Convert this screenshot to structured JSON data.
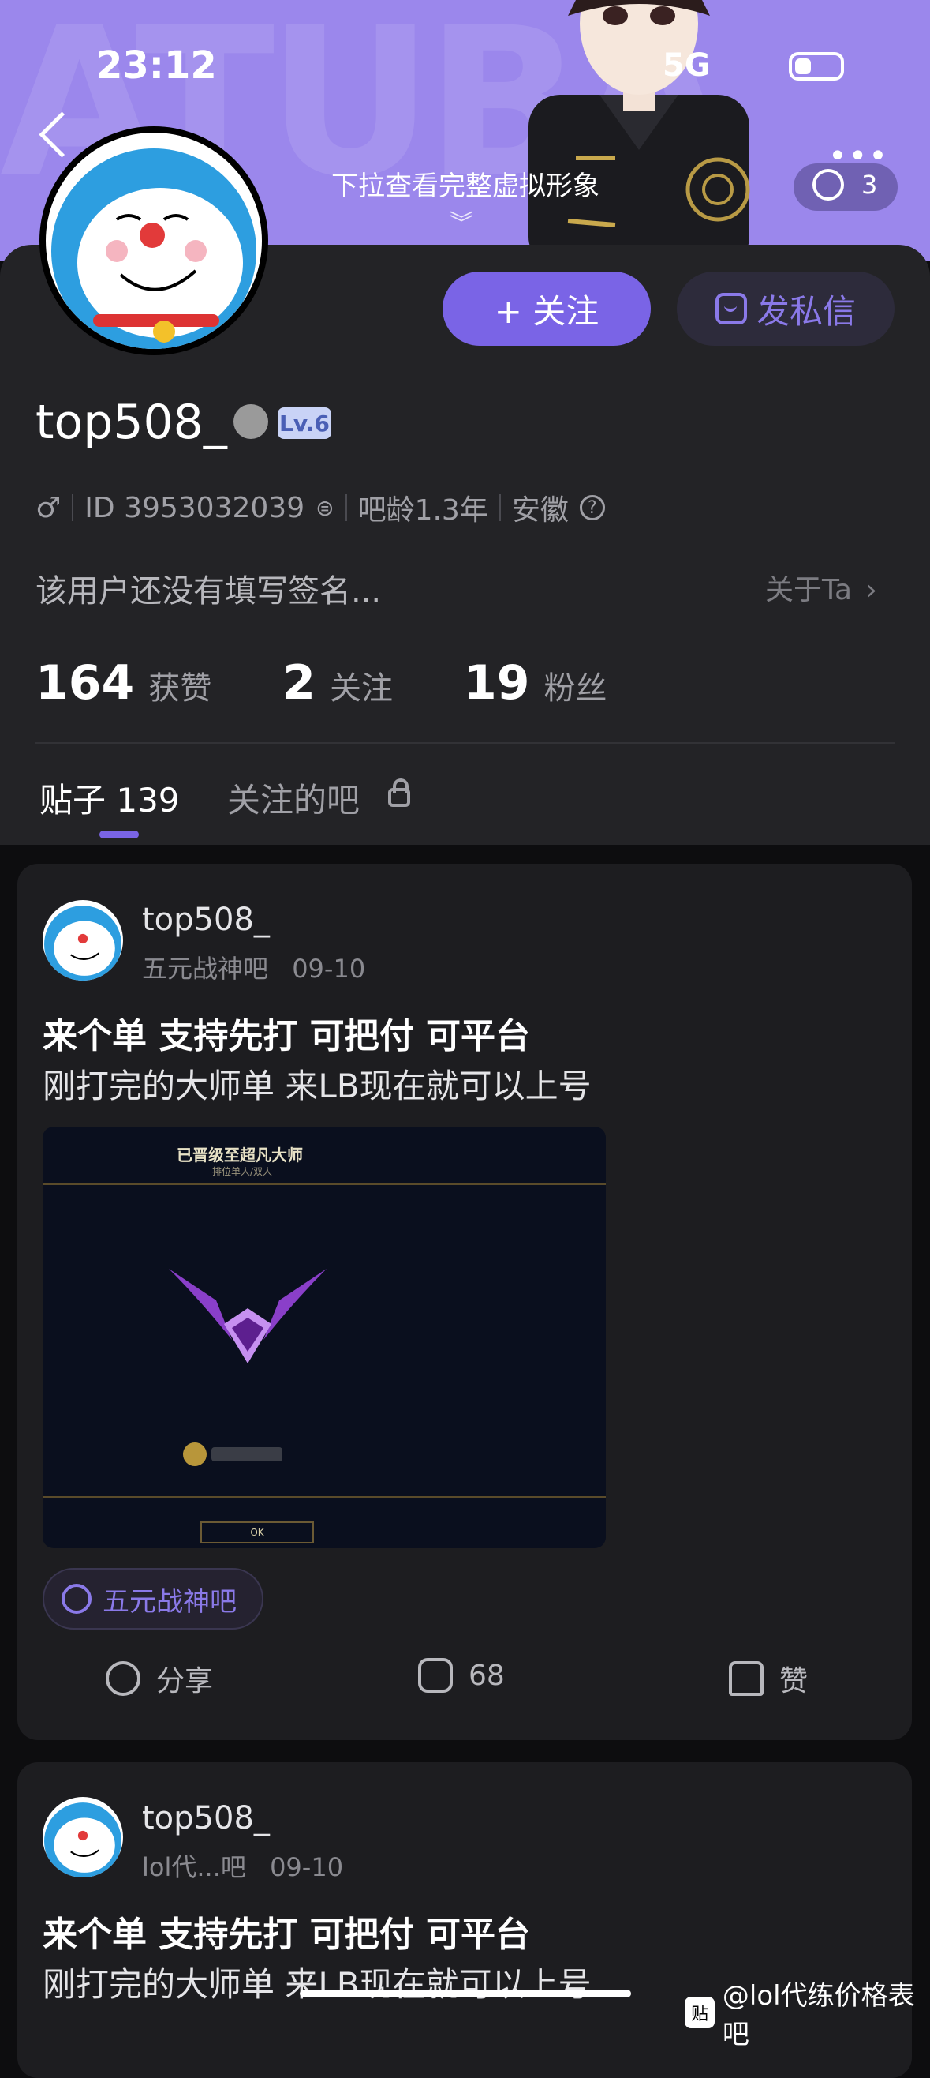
{
  "status_bar": {
    "time": "23:12",
    "network": "5G"
  },
  "header": {
    "pull_hint": "下拉查看完整虚拟形象",
    "visitor_count": "3",
    "bg_color": "#9b87ec"
  },
  "profile": {
    "username": "top508_",
    "level": "Lv.6",
    "gender_symbol": "♂",
    "id_text": "ID 3953032039",
    "bar_age": "吧龄1.3年",
    "location": "安徽",
    "signature": "该用户还没有填写签名...",
    "about_label": "关于Ta",
    "follow_button": "+ 关注",
    "message_button": "发私信",
    "stats": [
      {
        "value": "164",
        "label": "获赞"
      },
      {
        "value": "2",
        "label": "关注"
      },
      {
        "value": "19",
        "label": "粉丝"
      }
    ]
  },
  "tabs": [
    {
      "label": "贴子 139",
      "active": true
    },
    {
      "label": "关注的吧",
      "active": false
    }
  ],
  "posts": [
    {
      "user": "top508_",
      "forum": "五元战神吧",
      "date": "09-10",
      "title": "来个单 支持先打 可把付 可平台",
      "body": "刚打完的大师单 来LB现在就可以上号",
      "image_heading": "已晋级至超凡大师",
      "image_subheading": "排位单人/双人",
      "image_button": "OK",
      "tag": "五元战神吧",
      "actions": {
        "share": "分享",
        "comments": "68",
        "like": "赞"
      }
    },
    {
      "user": "top508_",
      "forum": "lol代...吧",
      "date": "09-10",
      "title": "来个单 支持先打 可把付 可平台",
      "body": "刚打完的大师单 来LB现在就可以上号"
    }
  ],
  "watermark": {
    "badge": "贴",
    "text": "@lol代练价格表吧"
  },
  "colors": {
    "accent": "#7a64e6",
    "panel": "#232326",
    "card": "#1d1d20"
  }
}
